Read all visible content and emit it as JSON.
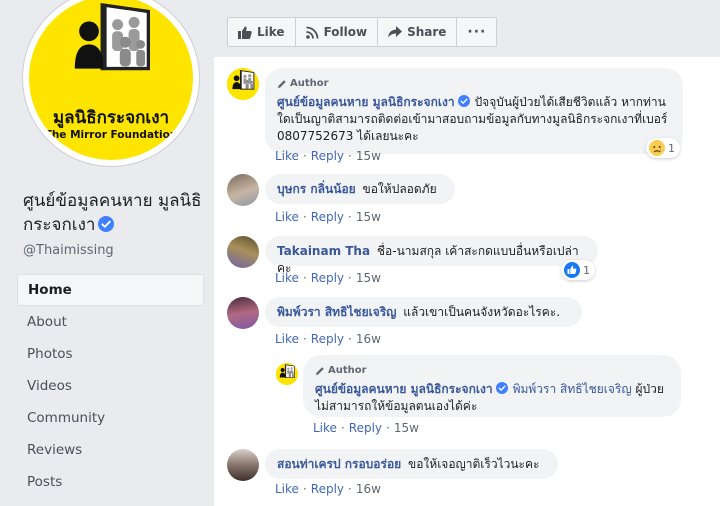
{
  "logo": {
    "caption_thai": "มูลนิธิกระจกเงา",
    "caption_en": "The Mirror Foundation"
  },
  "page": {
    "name": "ศูนย์ข้อมูลคนหาย มูลนิธิกระจกเงา",
    "handle": "@Thaimissing"
  },
  "nav": {
    "items": [
      {
        "label": "Home"
      },
      {
        "label": "About"
      },
      {
        "label": "Photos"
      },
      {
        "label": "Videos"
      },
      {
        "label": "Community"
      },
      {
        "label": "Reviews"
      },
      {
        "label": "Posts"
      }
    ]
  },
  "actions": {
    "like": "Like",
    "follow": "Follow",
    "share": "Share",
    "more": "···"
  },
  "comments": [
    {
      "author_badge": "Author",
      "name": "ศูนย์ข้อมูลคนหาย มูลนิธิกระจกเงา",
      "text": "ปัจจุบันผู้ป่วยได้เสียชีวิตแล้ว หากท่านใดเป็นญาติสามารถติดต่อเข้ามาสอบถามข้อมูลกับทางมูลนิธิกระจกเงาที่เบอร์ 0807752673 ได้เลยนะคะ",
      "like": "Like",
      "reply": "Reply",
      "time": "15w",
      "reaction_count": "1"
    },
    {
      "name": "บุษกร กลิ่นน้อย",
      "text": "ขอให้ปลอดภัย",
      "like": "Like",
      "reply": "Reply",
      "time": "15w"
    },
    {
      "name": "Takainam Tha",
      "text": "ชื่อ-นามสกุล เค้าสะกดแบบอื่นหรือเปล่าคะ",
      "like": "Like",
      "reply": "Reply",
      "time": "15w",
      "reaction_count": "1"
    },
    {
      "name": "พิมพ์วรา สิทธิไชยเจริญ",
      "text": "แล้วเขาเป็นคนจังหวัดอะไรคะ.",
      "like": "Like",
      "reply": "Reply",
      "time": "16w"
    },
    {
      "author_badge": "Author",
      "name": "ศูนย์ข้อมูลคนหาย มูลนิธิกระจกเงา",
      "mention": "พิมพ์วรา สิทธิไชยเจริญ",
      "text": "ผู้ป่วยไม่สามารถให้ข้อมูลตนเองได้ค่ะ",
      "like": "Like",
      "reply": "Reply",
      "time": "15w"
    },
    {
      "name": "สอนท่าเครป กรอบอร่อย",
      "text": "ขอให้เจอญาติเร็วไวนะคะ",
      "like": "Like",
      "reply": "Reply",
      "time": "16w"
    }
  ],
  "colors": {
    "link": "#385898",
    "brand_yellow": "#fde500",
    "verified": "#4080ff"
  }
}
